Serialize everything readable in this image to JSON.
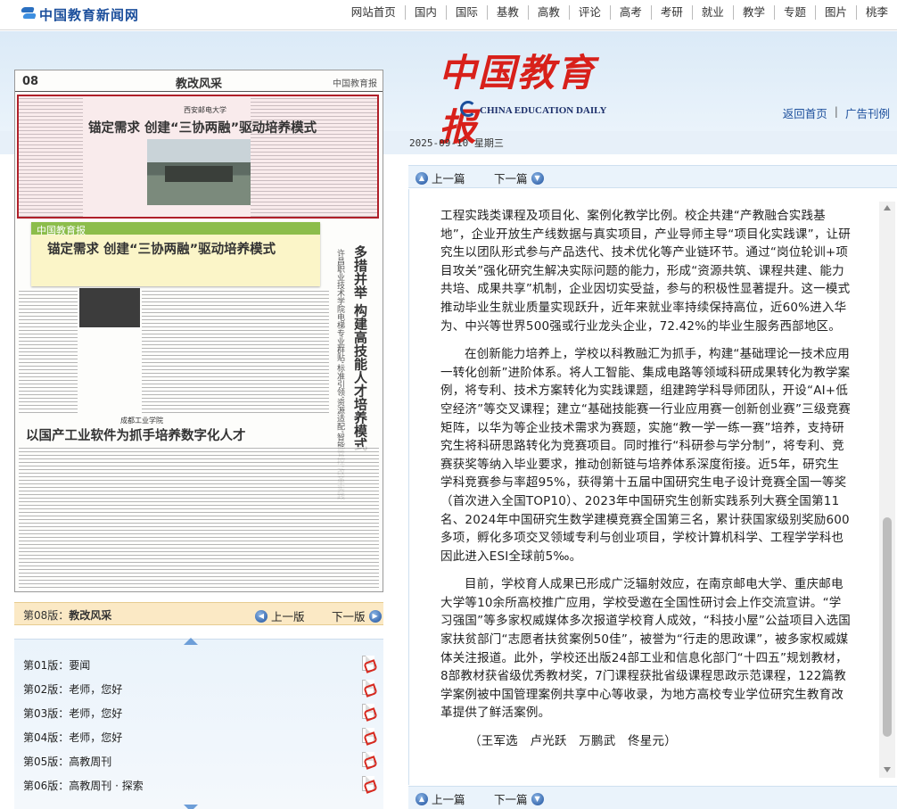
{
  "site": {
    "logo_text": "中国教育新闻网",
    "nav": [
      "网站首页",
      "国内",
      "国际",
      "基教",
      "高教",
      "评论",
      "高考",
      "考研",
      "就业",
      "教学",
      "专题",
      "图片",
      "桃李"
    ]
  },
  "header": {
    "paper_name": "中国教育报",
    "paper_name_en": "CHINA EDUCATION DAILY",
    "links": [
      "返回首页",
      "广告刊例"
    ],
    "link_sep": "|",
    "date": "2025-09-10 星期三"
  },
  "newspaper": {
    "page_num": "08",
    "section": "教改风采",
    "brand": "中国教育报",
    "article1_sub": "西安邮电大学",
    "article1_title": "锚定需求 创建“三协两融”驱动培养模式",
    "tooltip_source": "中国教育报",
    "tooltip_title": "锚定需求 创建“三协两融”驱动培养模式",
    "vertical_title": "多措并举 构建高技能人才培养模式",
    "vertical_sub": "许昌职业技术学院电梯专业群贴‘标准引领’资源适配‘智能管控’改革实践",
    "article2_sub": "成都工业学院",
    "article2_title": "以国产工业软件为抓手培养数字化人才"
  },
  "pagebar": {
    "current_label": "第08版：",
    "current_name": "教改风采",
    "prev": "上一版",
    "next": "下一版"
  },
  "pagelist": [
    {
      "num": "第01版",
      "sep": "：",
      "name": "要闻"
    },
    {
      "num": "第02版",
      "sep": "：",
      "name": "老师，您好"
    },
    {
      "num": "第03版",
      "sep": "：",
      "name": "老师，您好"
    },
    {
      "num": "第04版",
      "sep": "：",
      "name": "老师，您好"
    },
    {
      "num": "第05版",
      "sep": "：",
      "name": "高教周刊"
    },
    {
      "num": "第06版",
      "sep": "：",
      "name": "高教周刊 · 探索"
    }
  ],
  "article_nav": {
    "prev": "上一篇",
    "next": "下一篇"
  },
  "article": {
    "paragraphs": [
      "工程实践类课程及项目化、案例化教学比例。校企共建“产教融合实践基地”，企业开放生产线数据与真实项目，产业导师主导“项目化实践课”，让研究生以团队形式参与产品迭代、技术优化等产业链环节。通过“岗位轮训+项目攻关”强化研究生解决实际问题的能力，形成“资源共筑、课程共建、能力共培、成果共享”机制，企业因切实受益，参与的积极性显著提升。这一模式推动毕业生就业质量实现跃升，近年来就业率持续保持高位，近60%进入华为、中兴等世界500强或行业龙头企业，72.42%的毕业生服务西部地区。",
      "在创新能力培养上，学校以科教融汇为抓手，构建“基础理论一技术应用一转化创新”进阶体系。将人工智能、集成电路等领域科研成果转化为教学案例，将专利、技术方案转化为实践课题，组建跨学科导师团队，开设“AI+低空经济”等交叉课程；建立“基础技能赛一行业应用赛一创新创业赛”三级竞赛矩阵，以华为等企业技术需求为赛题，实施“教一学一练一赛”培养，支持研究生将科研思路转化为竞赛项目。同时推行“科研参与学分制”，将专利、竞赛获奖等纳入毕业要求，推动创新链与培养体系深度衔接。近5年，研究生学科竞赛参与率超95%，获得第十五届中国研究生电子设计竞赛全国一等奖（首次进入全国TOP10）、2023年中国研究生创新实践系列大赛全国第11名、2024年中国研究生数学建模竞赛全国第三名，累计获国家级别奖励600多项，孵化多项交叉领域专利与创业项目，学校计算机科学、工程学学科也因此进入ESI全球前5‰。",
      "目前，学校育人成果已形成广泛辐射效应，在南京邮电大学、重庆邮电大学等10余所高校推广应用，学校受邀在全国性研讨会上作交流宣讲。“学习强国”等多家权威媒体多次报道学校育人成效，“科技小屋”公益项目入选国家扶贫部门“志愿者扶贫案例50佳”，被誉为“行走的思政课”，被多家权威媒体关注报道。此外，学校还出版24部工业和信息化部门“十四五”规划教材，8部教材获省级优秀教材奖，7门课程获批省级课程思政示范课程，122篇教学案例被中国管理案例共享中心等收录，为地方高校专业学位研究生教育改革提供了鲜活案例。"
    ],
    "signature": "（王军选　卢光跃　万鹏武　佟星元）"
  }
}
